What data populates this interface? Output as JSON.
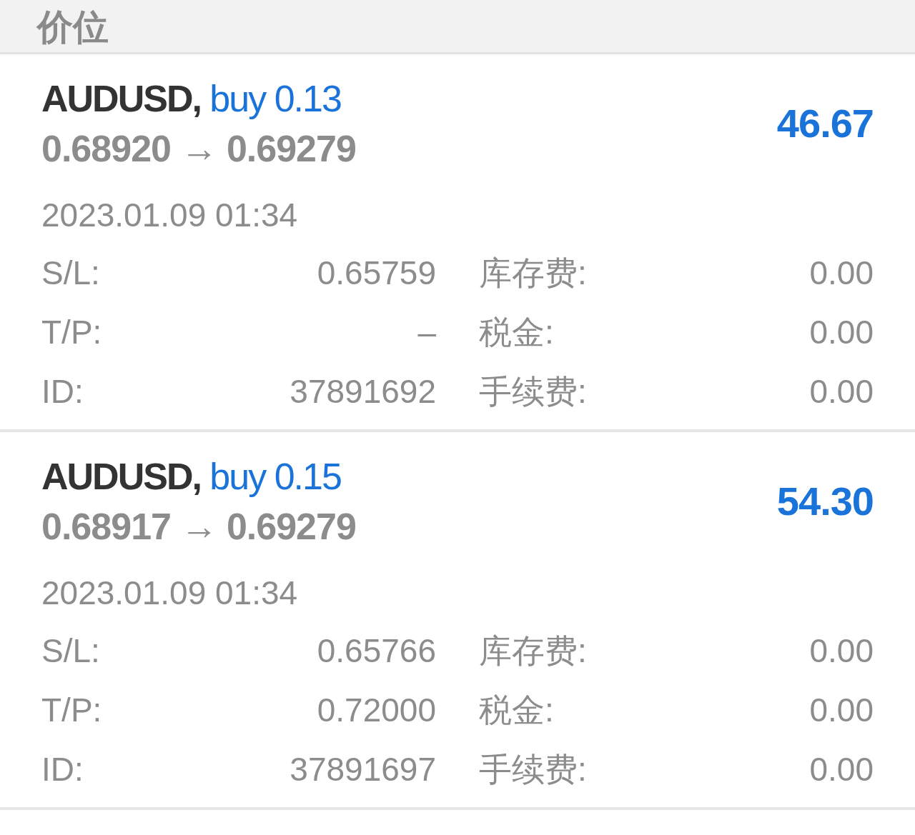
{
  "header": {
    "title": "价位"
  },
  "positions": [
    {
      "symbol": "AUDUSD,",
      "side": "buy 0.13",
      "open_price": "0.68920",
      "arrow": "→",
      "current_price": "0.69279",
      "profit": "46.67",
      "time": "2023.01.09 01:34",
      "details": [
        {
          "label": "S/L:",
          "value": "0.65759"
        },
        {
          "label": "库存费:",
          "value": "0.00"
        },
        {
          "label": "T/P:",
          "value": "–"
        },
        {
          "label": "税金:",
          "value": "0.00"
        },
        {
          "label": "ID:",
          "value": "37891692"
        },
        {
          "label": "手续费:",
          "value": "0.00"
        }
      ]
    },
    {
      "symbol": "AUDUSD,",
      "side": "buy 0.15",
      "open_price": "0.68917",
      "arrow": "→",
      "current_price": "0.69279",
      "profit": "54.30",
      "time": "2023.01.09 01:34",
      "details": [
        {
          "label": "S/L:",
          "value": "0.65766"
        },
        {
          "label": "库存费:",
          "value": "0.00"
        },
        {
          "label": "T/P:",
          "value": "0.72000"
        },
        {
          "label": "税金:",
          "value": "0.00"
        },
        {
          "label": "ID:",
          "value": "37891697"
        },
        {
          "label": "手续费:",
          "value": "0.00"
        }
      ]
    }
  ]
}
